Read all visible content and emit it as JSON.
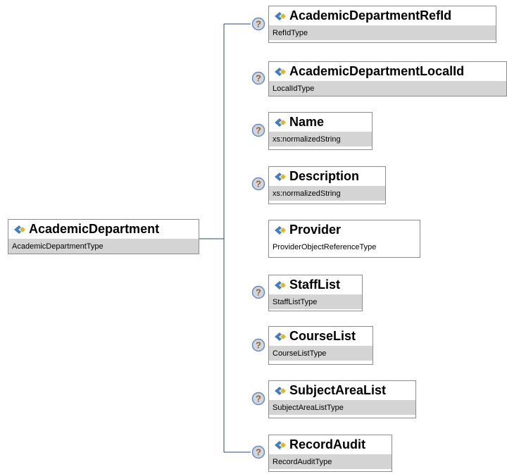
{
  "root": {
    "name": "AcademicDepartment",
    "type": "AcademicDepartmentType"
  },
  "children": [
    {
      "name": "AcademicDepartmentRefId",
      "type": "RefIdType",
      "optional": true
    },
    {
      "name": "AcademicDepartmentLocalId",
      "type": "LocalIdType",
      "optional": true
    },
    {
      "name": "Name",
      "type": "xs:normalizedString",
      "optional": true
    },
    {
      "name": "Description",
      "type": "xs:normalizedString",
      "optional": true
    },
    {
      "name": "Provider",
      "type": "ProviderObjectReferenceType",
      "optional": false
    },
    {
      "name": "StaffList",
      "type": "StaffListType",
      "optional": true
    },
    {
      "name": "CourseList",
      "type": "CourseListType",
      "optional": true
    },
    {
      "name": "SubjectAreaList",
      "type": "SubjectAreaListType",
      "optional": true
    },
    {
      "name": "RecordAudit",
      "type": "RecordAuditType",
      "optional": true
    }
  ],
  "optional_marker": "?",
  "colors": {
    "border": "#8c8c8c",
    "type_band": "#d4d4d4",
    "connector": "#1f4e79",
    "icon_blue": "#3f7fbf",
    "icon_gold": "#e6b422",
    "optional_fill": "#c9d7e8"
  },
  "icons": {
    "element": "element-diamond-icon",
    "optional": "optional-question-icon"
  }
}
